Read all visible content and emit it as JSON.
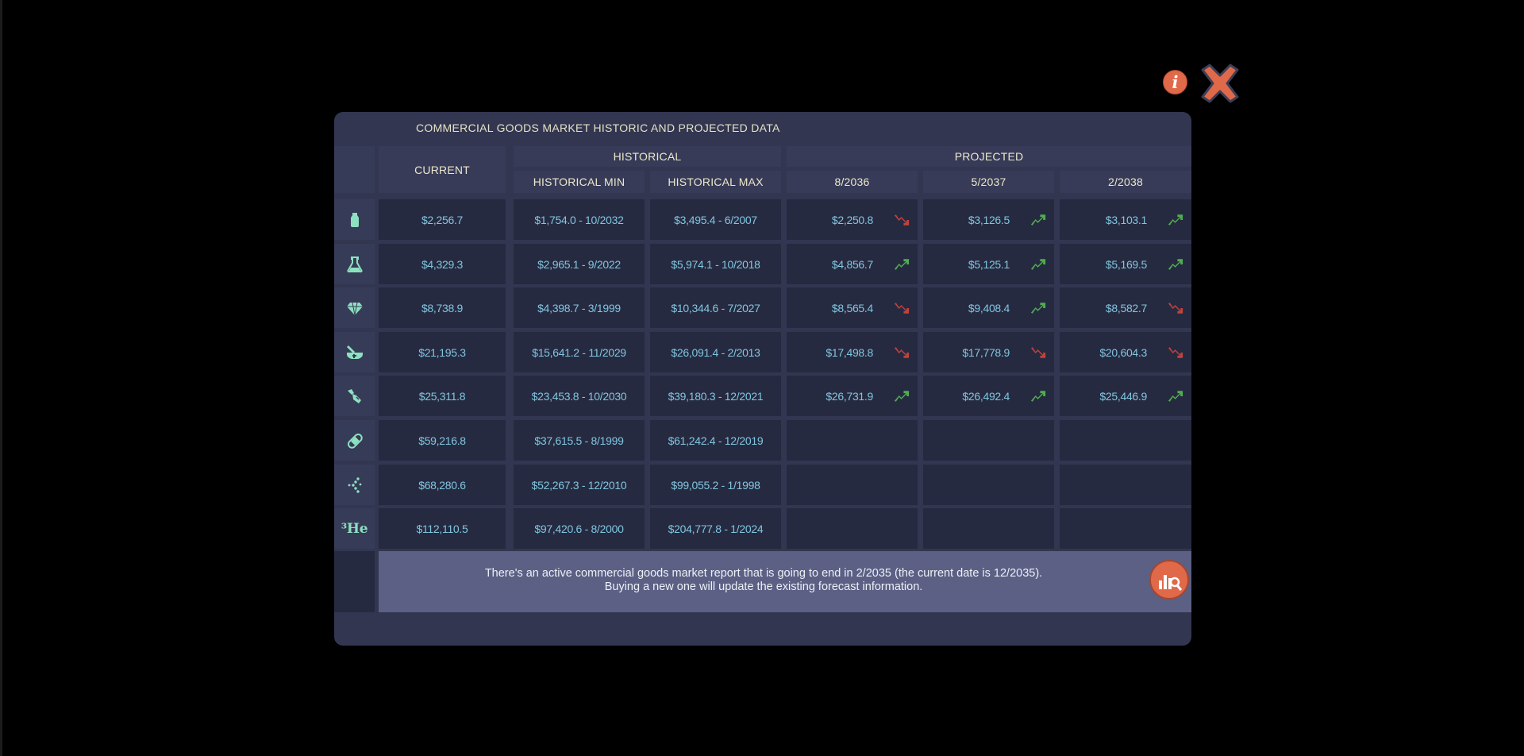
{
  "title": "COMMERCIAL GOODS MARKET HISTORIC AND PROJECTED DATA",
  "headers": {
    "current": "CURRENT",
    "historical": "HISTORICAL",
    "projected": "PROJECTED",
    "hist_min": "HISTORICAL MIN",
    "hist_max": "HISTORICAL MAX",
    "proj_dates": [
      "8/2036",
      "5/2037",
      "2/2038"
    ]
  },
  "rows": [
    {
      "icon": "vase-icon",
      "current": "$2,256.7",
      "min": "$1,754.0 - 10/2032",
      "max": "$3,495.4 - 6/2007",
      "proj": [
        {
          "value": "$2,250.8",
          "trend": "down"
        },
        {
          "value": "$3,126.5",
          "trend": "up"
        },
        {
          "value": "$3,103.1",
          "trend": "up"
        }
      ]
    },
    {
      "icon": "flask-icon",
      "current": "$4,329.3",
      "min": "$2,965.1 - 9/2022",
      "max": "$5,974.1 - 10/2018",
      "proj": [
        {
          "value": "$4,856.7",
          "trend": "up"
        },
        {
          "value": "$5,125.1",
          "trend": "up"
        },
        {
          "value": "$5,169.5",
          "trend": "up"
        }
      ]
    },
    {
      "icon": "gem-icon",
      "current": "$8,738.9",
      "min": "$4,398.7 - 3/1999",
      "max": "$10,344.6 - 7/2027",
      "proj": [
        {
          "value": "$8,565.4",
          "trend": "down"
        },
        {
          "value": "$9,408.4",
          "trend": "up"
        },
        {
          "value": "$8,582.7",
          "trend": "down"
        }
      ]
    },
    {
      "icon": "mortar-pestle-icon",
      "current": "$21,195.3",
      "min": "$15,641.2 - 11/2029",
      "max": "$26,091.4 - 2/2013",
      "proj": [
        {
          "value": "$17,498.8",
          "trend": "down"
        },
        {
          "value": "$17,778.9",
          "trend": "down"
        },
        {
          "value": "$20,604.3",
          "trend": "down"
        }
      ]
    },
    {
      "icon": "drill-icon",
      "current": "$25,311.8",
      "min": "$23,453.8 - 10/2030",
      "max": "$39,180.3 - 12/2021",
      "proj": [
        {
          "value": "$26,731.9",
          "trend": "up"
        },
        {
          "value": "$26,492.4",
          "trend": "up"
        },
        {
          "value": "$25,446.9",
          "trend": "up"
        }
      ]
    },
    {
      "icon": "bandage-icon",
      "current": "$59,216.8",
      "min": "$37,615.5 - 8/1999",
      "max": "$61,242.4 - 12/2019",
      "proj": []
    },
    {
      "icon": "molecule-icon",
      "current": "$68,280.6",
      "min": "$52,267.3 - 12/2010",
      "max": "$99,055.2 - 1/1998",
      "proj": []
    },
    {
      "icon": "helium3-icon",
      "icon_text": "³He",
      "current": "$112,110.5",
      "min": "$97,420.6 - 8/2000",
      "max": "$204,777.8 - 1/2024",
      "proj": []
    }
  ],
  "report": {
    "line1": "There's an active commercial goods market report that is going to end in 2/2035 (the current date is 12/2035).",
    "line2": "Buying a new one will update the existing forecast information."
  },
  "colors": {
    "up": "#4fae4f",
    "down": "#c2423c",
    "accent": "#e0694a",
    "icon": "#8de0c0"
  }
}
